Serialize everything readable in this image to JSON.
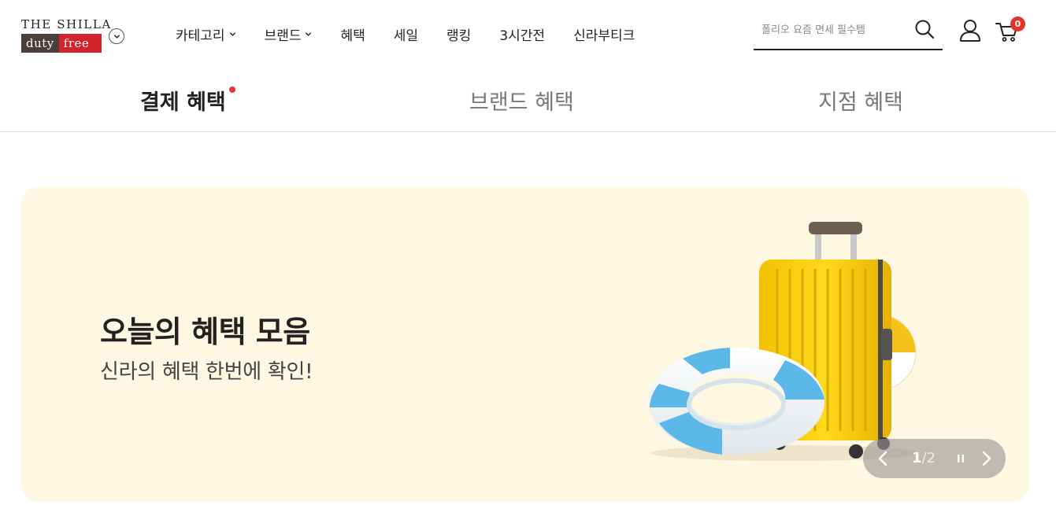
{
  "header": {
    "logo": {
      "top_text": "THE SHILLA",
      "duty_text": "duty",
      "free_text": "free"
    },
    "nav": [
      {
        "label": "카테고리",
        "dropdown": true
      },
      {
        "label": "브랜드",
        "dropdown": true
      },
      {
        "label": "혜택",
        "dropdown": false
      },
      {
        "label": "세일",
        "dropdown": false
      },
      {
        "label": "랭킹",
        "dropdown": false
      },
      {
        "label": "3시간전",
        "dropdown": false
      },
      {
        "label": "신라부티크",
        "dropdown": false
      }
    ],
    "search": {
      "placeholder": "폴리오 요즘 면세 필수템"
    },
    "cart_count": "0"
  },
  "tabs": [
    {
      "label": "결제 혜택",
      "active": true
    },
    {
      "label": "브랜드 혜택",
      "active": false
    },
    {
      "label": "지점 혜택",
      "active": false
    }
  ],
  "banner": {
    "title": "오늘의 혜택 모음",
    "subtitle": "신라의 혜택 한번에 확인!",
    "illustration": "suitcase-swim-ring-beach-ball",
    "pager": {
      "current": "1",
      "separator": "/",
      "total": "2"
    }
  },
  "colors": {
    "accent_red": "#e5322d",
    "logo_brown": "#4a3f3a",
    "logo_red": "#d2232a",
    "banner_bg": "#fef7e1"
  }
}
